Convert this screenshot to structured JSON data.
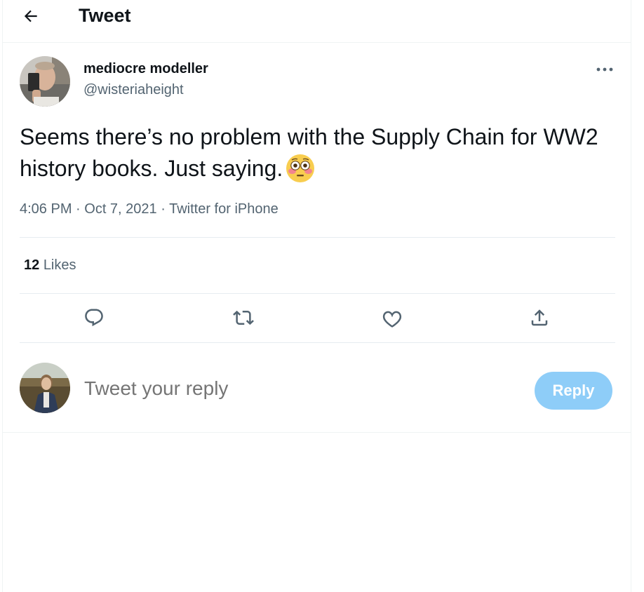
{
  "header": {
    "title": "Tweet",
    "back_icon": "arrow-left-icon"
  },
  "tweet": {
    "author": {
      "name": "mediocre modeller",
      "handle": "@wisteriaheight"
    },
    "text": "Seems there’s no problem with the Supply Chain for WW2 history books. Just saying.",
    "emoji": "flushed-face-emoji",
    "time": "4:06 PM",
    "date": "Oct 7, 2021",
    "source": "Twitter for iPhone",
    "separator": " · ",
    "likes_count": "12",
    "likes_label": "Likes"
  },
  "actions": [
    {
      "name": "reply-icon"
    },
    {
      "name": "retweet-icon"
    },
    {
      "name": "like-icon"
    },
    {
      "name": "share-icon"
    }
  ],
  "reply": {
    "placeholder": "Tweet your reply",
    "button_label": "Reply"
  },
  "colors": {
    "text": "#0f1419",
    "secondary": "#536471",
    "accent_disabled": "#8ecdf8",
    "border": "#eff3f4"
  }
}
